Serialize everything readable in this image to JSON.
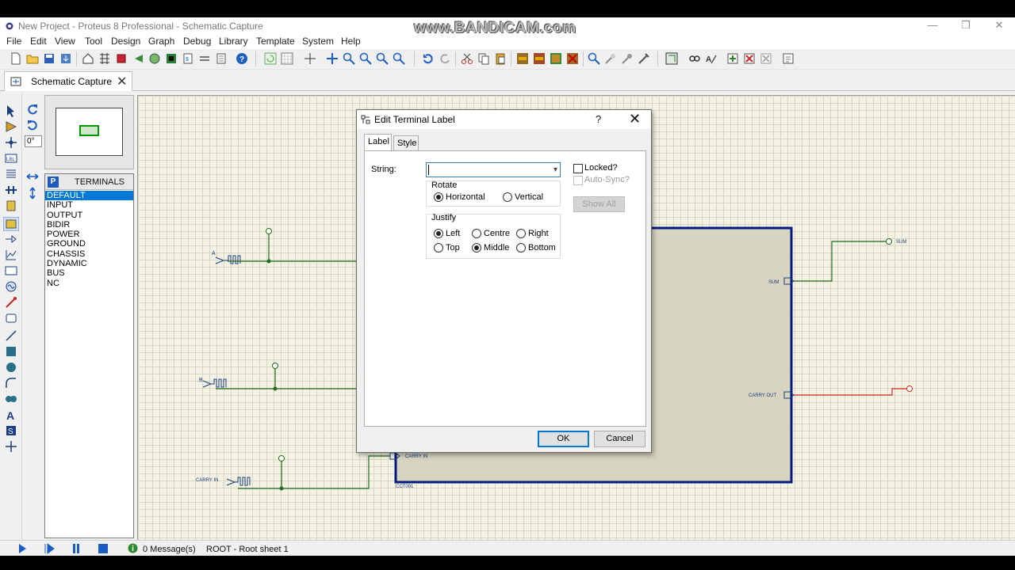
{
  "window": {
    "title": "New Project - Proteus 8 Professional - Schematic Capture",
    "watermark": "www.BANDICAM.com",
    "min_glyph": "—",
    "max_glyph": "❐",
    "close_glyph": "✕"
  },
  "menu": [
    "File",
    "Edit",
    "View",
    "Tool",
    "Design",
    "Graph",
    "Debug",
    "Library",
    "Template",
    "System",
    "Help"
  ],
  "toolbar_icons": [
    "new-icon",
    "open-icon",
    "save-icon",
    "import-icon",
    "home-icon",
    "bom-icon",
    "chip-icon",
    "back-icon",
    "gallery-icon",
    "pcb-icon",
    "netlist-icon",
    "doc-icon",
    "help-icon",
    "refresh-icon",
    "grid-icon",
    "origin-icon",
    "pan-icon",
    "zoom-in-icon",
    "zoom-out-icon",
    "zoom-all-icon",
    "zoom-area-icon",
    "undo-icon",
    "redo-icon",
    "cut-icon",
    "copy-icon",
    "paste-icon",
    "block-copy-icon",
    "block-move-icon",
    "block-rotate-icon",
    "block-delete-icon",
    "pick-device-icon",
    "make-device-icon",
    "packaging-icon",
    "decompose-icon",
    "wire-autorouter-icon",
    "search-icon",
    "property-tool-icon",
    "new-sheet-icon",
    "remove-sheet-icon",
    "exit-parent-icon",
    "design-explorer-icon"
  ],
  "tab": {
    "label": "Schematic Capture",
    "close": "✕"
  },
  "orientation": {
    "angle": "0°"
  },
  "picker": {
    "badge": "P",
    "title": "TERMINALS",
    "items": [
      "DEFAULT",
      "INPUT",
      "OUTPUT",
      "BIDIR",
      "POWER",
      "GROUND",
      "CHASSIS",
      "DYNAMIC",
      "BUS",
      "NC"
    ],
    "selected": "DEFAULT"
  },
  "schematic": {
    "labels": {
      "a": "A",
      "b": "B",
      "carry_in_src": "CARRY IN",
      "carry_in_pin": "CARRY IN",
      "sum_pin": "SUM",
      "carry_out_pin": "CARRY OUT",
      "sum_out": "SUM",
      "block_ref": "CCT001"
    },
    "colors": {
      "wire": "#1f6b1f",
      "bus_out": "#d62828",
      "block_border": "#001a80",
      "block_fill": "#d7d4c0"
    }
  },
  "dialog": {
    "title": "Edit Terminal Label",
    "help": "?",
    "close": "✕",
    "tabs": [
      "Label",
      "Style"
    ],
    "string_label": "String:",
    "string_value": "",
    "rotate": {
      "title": "Rotate",
      "options": [
        "Horizontal",
        "Vertical"
      ],
      "selected": "Horizontal"
    },
    "justify": {
      "title": "Justify",
      "options": [
        "Left",
        "Centre",
        "Right",
        "Top",
        "Middle",
        "Bottom"
      ],
      "selected": [
        "Left",
        "Middle"
      ]
    },
    "locked_label": "Locked?",
    "locked": false,
    "autosync_label": "Auto-Sync?",
    "autosync_enabled": false,
    "show_all": "Show All",
    "ok": "OK",
    "cancel": "Cancel"
  },
  "status": {
    "messages": "0 Message(s)",
    "sheet": "ROOT - Root sheet 1"
  }
}
